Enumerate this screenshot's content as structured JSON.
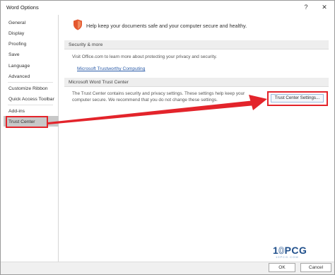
{
  "window": {
    "title": "Word Options",
    "help_glyph": "?",
    "close_glyph": "✕"
  },
  "nav": {
    "items": [
      {
        "label": "General"
      },
      {
        "label": "Display"
      },
      {
        "label": "Proofing"
      },
      {
        "label": "Save"
      },
      {
        "label": "Language"
      },
      {
        "label": "Advanced"
      },
      {
        "label": "Customize Ribbon"
      },
      {
        "label": "Quick Access Toolbar"
      },
      {
        "label": "Add-ins"
      },
      {
        "label": "Trust Center"
      }
    ],
    "selected": "Trust Center"
  },
  "header": {
    "text": "Help keep your documents safe and your computer secure and healthy.",
    "icon": "shield-icon"
  },
  "security_more": {
    "title": "Security & more",
    "text": "Visit Office.com to learn more about protecting your privacy and security.",
    "link": "Microsoft Trustworthy Computing"
  },
  "trust_center": {
    "title": "Microsoft Word Trust Center",
    "line1": "The Trust Center contains security and privacy settings. These settings help keep your",
    "line2": "computer secure. We recommend that you do not change these settings.",
    "button": "Trust Center Settings..."
  },
  "footer": {
    "ok": "OK",
    "cancel": "Cancel"
  },
  "watermark": {
    "text_a": "1",
    "text_b": "0",
    "text_c": "PCG",
    "sub": "10PCG.COM"
  },
  "colors": {
    "accent_red": "#e3242b",
    "link_blue": "#2a5ba8",
    "nav_selected": "#c8c8c8",
    "shield_orange": "#e4572e"
  }
}
